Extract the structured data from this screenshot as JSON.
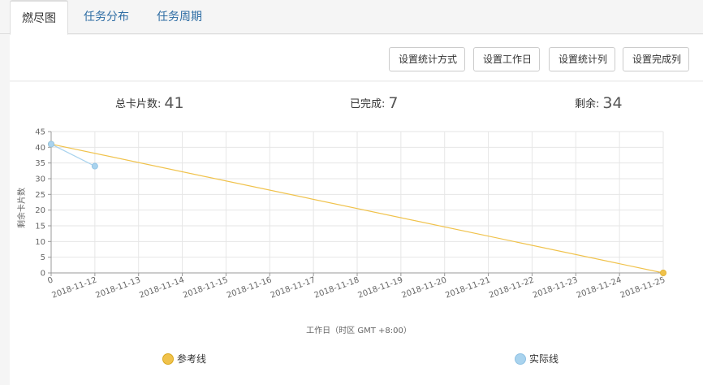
{
  "tabs": [
    {
      "label": "燃尽图",
      "active": true
    },
    {
      "label": "任务分布",
      "active": false
    },
    {
      "label": "任务周期",
      "active": false
    }
  ],
  "toolbar": {
    "buttons": [
      "设置统计方式",
      "设置工作日",
      "设置统计列",
      "设置完成列"
    ]
  },
  "stats": {
    "total_label": "总卡片数:",
    "total_value": "41",
    "done_label": "已完成:",
    "done_value": "7",
    "remaining_label": "剩余:",
    "remaining_value": "34"
  },
  "chart_data": {
    "type": "line",
    "x_first_tick": "0",
    "categories": [
      "2018-11-12",
      "2018-11-13",
      "2018-11-14",
      "2018-11-15",
      "2018-11-16",
      "2018-11-17",
      "2018-11-18",
      "2018-11-19",
      "2018-11-20",
      "2018-11-21",
      "2018-11-22",
      "2018-11-23",
      "2018-11-24",
      "2018-11-25"
    ],
    "xlabel": "工作日（时区 GMT +8:00）",
    "ylabel": "剩余卡片数",
    "ylim": [
      0,
      45
    ],
    "yticks": [
      0,
      5,
      10,
      15,
      20,
      25,
      30,
      35,
      40,
      45
    ],
    "grid": true,
    "legend_position": "bottom",
    "series": [
      {
        "name": "参考线",
        "color": "#f0c24b",
        "x": [
          "0",
          "2018-11-25"
        ],
        "values": [
          41,
          0
        ]
      },
      {
        "name": "实际线",
        "color": "#a9d3ee",
        "x": [
          "0",
          "2018-11-12"
        ],
        "values": [
          41,
          34
        ]
      }
    ]
  }
}
